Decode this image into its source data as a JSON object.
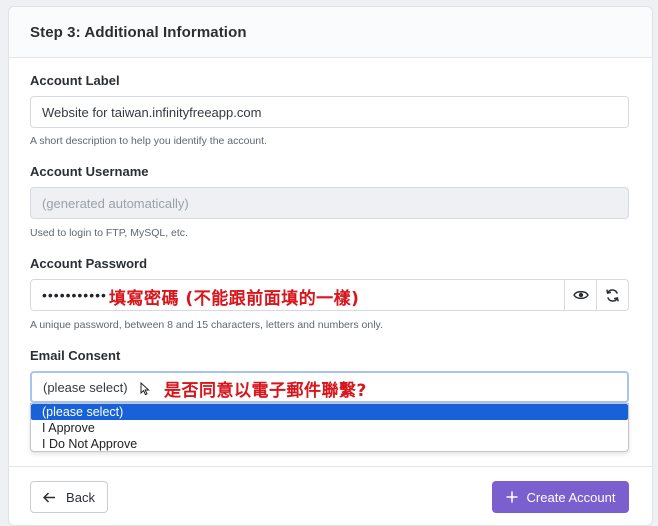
{
  "header": {
    "title": "Step 3: Additional Information"
  },
  "account_label": {
    "label": "Account Label",
    "value": "Website for taiwan.infinityfreeapp.com",
    "help": "A short description to help you identify the account."
  },
  "account_username": {
    "label": "Account Username",
    "placeholder": "(generated automatically)",
    "help": "Used to login to FTP, MySQL, etc."
  },
  "account_password": {
    "label": "Account Password",
    "value": "•••••••••••",
    "help": "A unique password, between 8 and 15 characters, letters and numbers only.",
    "annotation": "填寫密碼 (不能跟前面填的一樣)",
    "toggle_icon": "eye-icon",
    "regenerate_icon": "refresh-icon"
  },
  "email_consent": {
    "label": "Email Consent",
    "selected": "(please select)",
    "annotation": "是否同意以電子郵件聯繫?",
    "options": [
      "(please select)",
      "I Approve",
      "I Do Not Approve"
    ]
  },
  "footer": {
    "back_label": "Back",
    "create_label": "Create Account"
  },
  "colors": {
    "primary": "#7b5fcf",
    "selected_option": "#1762d8",
    "annotation": "#d8151b"
  }
}
